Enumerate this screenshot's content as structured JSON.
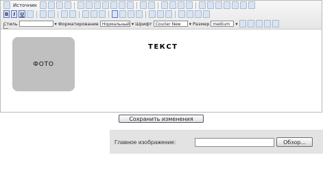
{
  "toolbar": {
    "source_label": "Источник",
    "bold_label": "B",
    "italic_label": "I",
    "underline_label": "U",
    "style_label": "Стиль",
    "style_value": "",
    "format_label": "Форматирование",
    "format_value": "Нормальный",
    "font_label": "Шрифт",
    "font_value": "Courier New",
    "size_label": "Размер",
    "size_value": "medium"
  },
  "content": {
    "photo_label": "ФОТО",
    "heading": "ТЕКСТ"
  },
  "save_button_label": "Сохранить изменения",
  "upload": {
    "label": "Главное изображение:",
    "input_value": "",
    "browse_label": "Обзор..."
  }
}
